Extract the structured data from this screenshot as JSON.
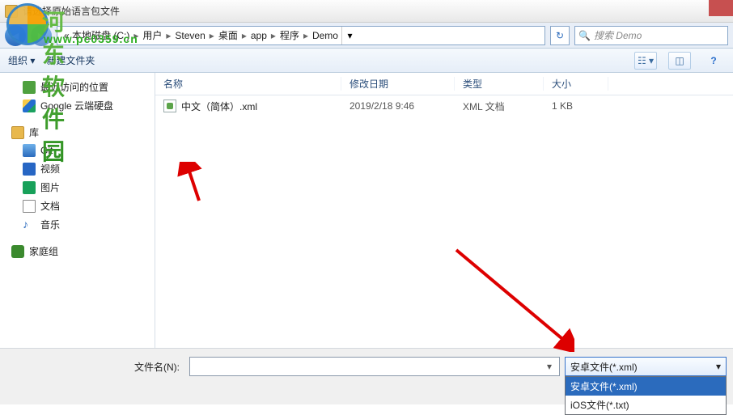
{
  "titlebar": {
    "title": "请选择原始语言包文件"
  },
  "breadcrumb": {
    "prefix": "« 本地磁盘 (C:)",
    "parts": [
      "用户",
      "Steven",
      "桌面",
      "app",
      "程序",
      "Demo"
    ]
  },
  "search": {
    "placeholder": "搜索 Demo"
  },
  "toolbar": {
    "organize": "组织 ▾",
    "newfolder": "新建文件夹"
  },
  "sidebar": {
    "recent": "最近访问的位置",
    "gdrive": "Google 云端硬盘",
    "lib": "库",
    "git": "Git",
    "video": "视频",
    "pic": "图片",
    "doc": "文档",
    "music": "音乐",
    "homegroup": "家庭组"
  },
  "columns": {
    "name": "名称",
    "date": "修改日期",
    "type": "类型",
    "size": "大小"
  },
  "files": [
    {
      "name": "中文（简体）.xml",
      "date": "2019/2/18 9:46",
      "type": "XML 文档",
      "size": "1 KB"
    }
  ],
  "bottom": {
    "filelabel": "文件名(N):",
    "typeSelected": "安卓文件(*.xml)",
    "options": [
      "安卓文件(*.xml)",
      "iOS文件(*.txt)"
    ]
  },
  "watermark": {
    "text": "河东软件园",
    "url": "www.pc0359.cn"
  }
}
